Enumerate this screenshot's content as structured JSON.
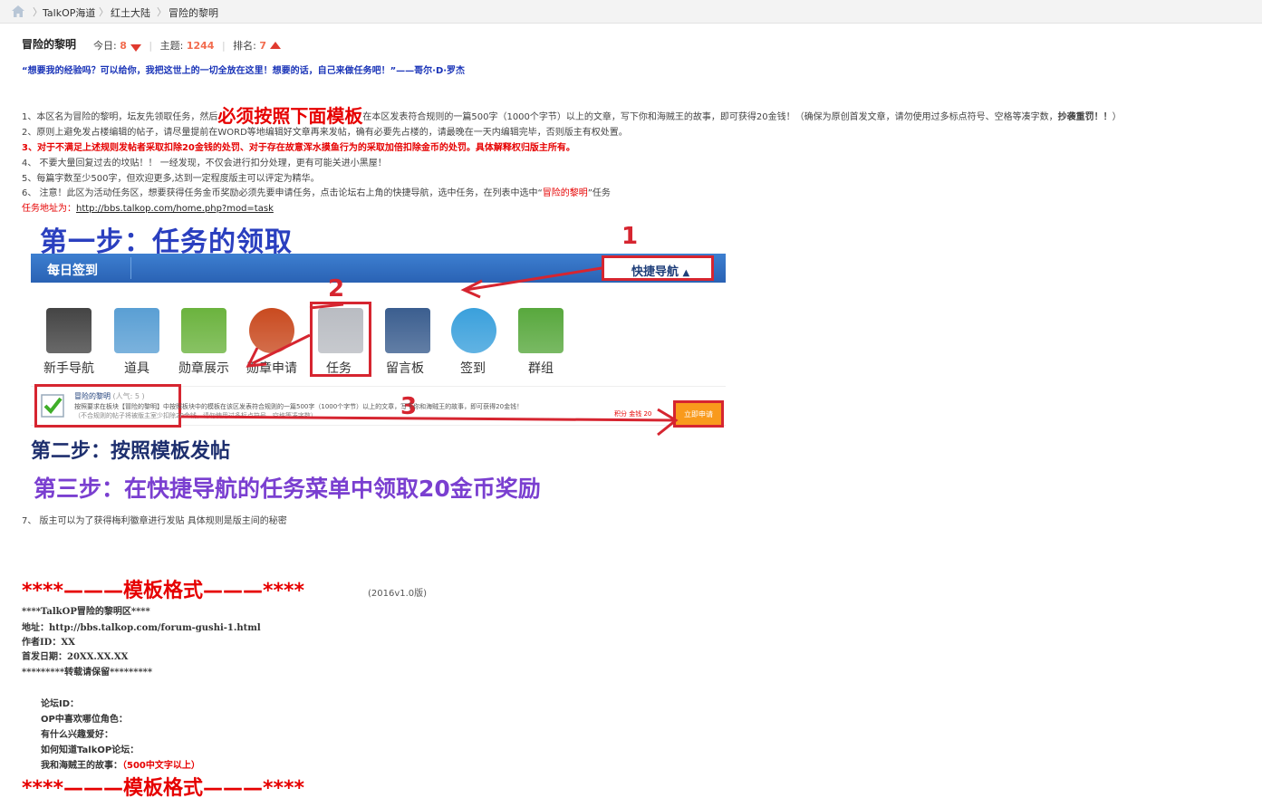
{
  "breadcrumb": {
    "items": [
      "TalkOP海道",
      "红土大陆",
      "冒险的黎明"
    ]
  },
  "forum": {
    "title": "冒险的黎明",
    "today_label": "今日:",
    "today_value": "8",
    "topics_label": "主题:",
    "topics_value": "1244",
    "rank_label": "排名:",
    "rank_value": "7"
  },
  "quote": "“想要我的经验吗？可以给你，我把这世上的一切全放在这里！想要的话，自己来做任务吧！”——哥尔·D·罗杰",
  "rules": {
    "r1_a": "1、本区名为冒险的黎明，坛友先领取任务，然后",
    "r1_big": "必须按照下面模板",
    "r1_b": "在本区发表符合规则的一篇500字（1000个字节）以上的文章，写下你和海贼王的故事，即可获得20金钱！（确保为原创首发文章，请勿使用过多标点符号、空格等凑字数，",
    "r1_bold": "抄袭重罚！！",
    "r1_c": "）",
    "r2": "2、原则上避免发占楼编辑的帖子，请尽量提前在WORD等地编辑好文章再来发帖，确有必要先占楼的，请最晚在一天内编辑完毕，否则版主有权处置。",
    "r3": "3、对于不满足上述规则发帖者采取扣除20金钱的处罚、对于存在故意浑水摸鱼行为的采取加倍扣除金币的处罚。具体解释权归版主所有。",
    "r4": "4、 不要大量回复过去的坟贴！！ 一经发现，不仅会进行扣分处理，更有可能关进小黑屋！",
    "r5": "5、每篇字数至少500字，但欢迎更多,达到一定程度版主可以评定为精华。",
    "r6_a": "6、 注意！此区为活动任务区，想要获得任务金币奖励必须先要申请任务，点击论坛右上角的快捷导航，选中任务，在列表中选中“",
    "r6_red": "冒险的黎明",
    "r6_b": "”任务",
    "task_addr_label": "任务地址为：",
    "task_addr_url": "http://bbs.talkop.com/home.php?mod=task",
    "r7": "7、 版主可以为了获得梅利徽章进行发贴 具体规则是版主间的秘密"
  },
  "banner": {
    "step1": "第一步：任务的领取",
    "checkin": "每日签到",
    "quick_nav": "快捷导航",
    "num1": "1",
    "num2": "2",
    "num3": "3",
    "icons": [
      {
        "label": "新手导航",
        "color": "#444444"
      },
      {
        "label": "道具",
        "color": "#5a9fd4"
      },
      {
        "label": "勋章展示",
        "color": "#6bb33e"
      },
      {
        "label": "勋章申请",
        "color": "#c94a1f"
      },
      {
        "label": "任务",
        "color": "#b9bcc2"
      },
      {
        "label": "留言板",
        "color": "#3b5e8f"
      },
      {
        "label": "签到",
        "color": "#3aa0dc"
      },
      {
        "label": "群组",
        "color": "#58a83d"
      }
    ],
    "task_title": "冒险的黎明",
    "task_popularity": "(人气: 5 )",
    "task_desc_1": "按照要求在板块【冒险的黎明】中按照板块中的模板在该区发表符合规则的一篇500字（1000个字节）以上的文章，写下你和海贼王的故事，即可获得20金钱！",
    "task_desc_2": "（不合规则的帖子将被版主室少扣除20金钱，请勿使用过多标点符号、空格等凑字数）",
    "reward": "积分 金钱 20",
    "apply": "立即申请",
    "step2": "第二步：按照模板发帖"
  },
  "step3": "第三步：在快捷导航的任务菜单中领取20金币奖励",
  "template": {
    "title": "****———模板格式———****",
    "version": "(2016v1.0版)",
    "line1": "****TalkOP冒险的黎明区****",
    "line2": "地址：http://bbs.talkop.com/forum-gushi-1.html",
    "line3": "作者ID：XX",
    "line4": "首发日期：20XX.XX.XX",
    "line5": "*********转载请保留*********",
    "field1": "论坛ID：",
    "field2": "OP中喜欢哪位角色：",
    "field3": "有什么兴趣爱好：",
    "field4": "如何知道TalkOP论坛：",
    "field5": "我和海贼王的故事：",
    "field5_red": "（500中文字以上）",
    "end": "****———模板格式———****"
  }
}
